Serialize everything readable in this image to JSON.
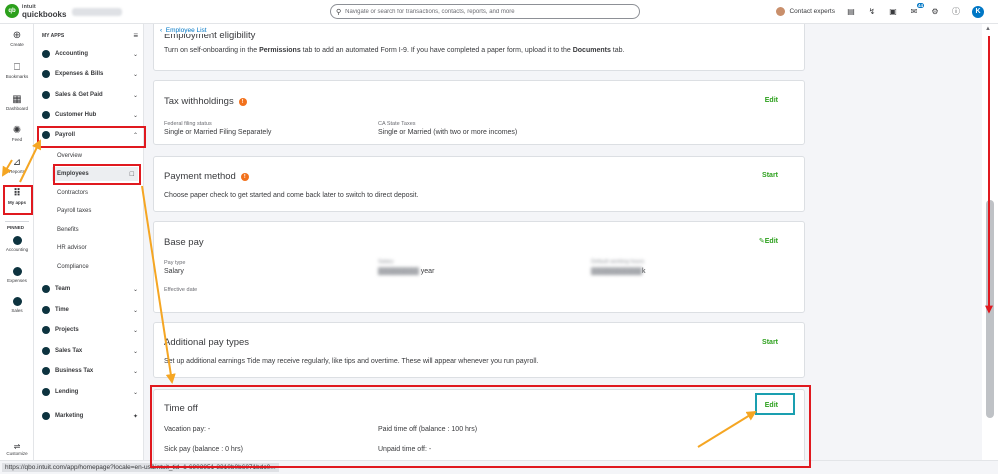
{
  "header": {
    "logo_brand": "intuit",
    "logo_product": "quickbooks",
    "logo_initials": "qb",
    "search_placeholder": "Navigate or search for transactions, contacts, reports, and more",
    "contact_label": "Contact experts",
    "notification_badge": "44",
    "avatar_initial": "K"
  },
  "rail": {
    "items": [
      {
        "label": "Create",
        "icon": "plus-circle-icon",
        "glyph": "⊕"
      },
      {
        "label": "Bookmarks",
        "icon": "bookmark-icon",
        "glyph": "⎕"
      },
      {
        "label": "Dashboard",
        "icon": "dashboard-icon",
        "glyph": "▦"
      },
      {
        "label": "Feed",
        "icon": "feed-icon",
        "glyph": "✺"
      },
      {
        "label": "Reports",
        "icon": "reports-icon",
        "glyph": "⊿"
      },
      {
        "label": "My apps",
        "icon": "apps-grid-icon",
        "glyph": "⠿"
      }
    ],
    "pinned_label": "PINNED",
    "pinned": [
      {
        "label": "Accounting"
      },
      {
        "label": "Expenses"
      },
      {
        "label": "Sales"
      }
    ],
    "bottom_label": "Customize"
  },
  "sidebar": {
    "heading": "MY APPS",
    "items": [
      {
        "label": "Accounting",
        "chevron": "⌄"
      },
      {
        "label": "Expenses & Bills",
        "chevron": "⌄"
      },
      {
        "label": "Sales & Get Paid",
        "chevron": "⌄"
      },
      {
        "label": "Customer Hub",
        "chevron": "⌄"
      },
      {
        "label": "Payroll",
        "chevron": "⌃"
      }
    ],
    "payroll_sub": [
      "Overview",
      "Employees",
      "Contractors",
      "Payroll taxes",
      "Benefits",
      "HR advisor",
      "Compliance"
    ],
    "items2": [
      {
        "label": "Team",
        "chevron": "⌄"
      },
      {
        "label": "Time",
        "chevron": "⌄"
      },
      {
        "label": "Projects",
        "chevron": "⌄"
      },
      {
        "label": "Sales Tax",
        "chevron": "⌄"
      },
      {
        "label": "Business Tax",
        "chevron": "⌄"
      },
      {
        "label": "Lending",
        "chevron": "⌄"
      }
    ],
    "marketing": "Marketing"
  },
  "main": {
    "back_label": "Employee List",
    "eligibility": {
      "title": "Employment eligibility",
      "desc_pre": "Turn on self-onboarding in the ",
      "desc_b1": "Permissions",
      "desc_mid": " tab to add an automated Form I-9. If you have completed a paper form, upload it to the ",
      "desc_b2": "Documents",
      "desc_post": " tab."
    },
    "tax": {
      "title": "Tax withholdings",
      "action": "Edit",
      "fed_label": "Federal filing status",
      "fed_value": "Single or Married Filing Separately",
      "state_label": "CA State Taxes",
      "state_value": "Single or Married (with two or more incomes)"
    },
    "payment": {
      "title": "Payment method",
      "action": "Start",
      "desc": "Choose paper check to get started and come back later to switch to direct deposit."
    },
    "basepay": {
      "title": "Base pay",
      "action": "Edit",
      "type_label": "Pay type",
      "type_value": "Salary",
      "salary_label": "Salary",
      "salary_value": "year",
      "hours_label": "Default working hours",
      "hours_value": "k",
      "effective_label": "Effective date"
    },
    "additional": {
      "title": "Additional pay types",
      "action": "Start",
      "desc": "Set up additional earnings Tide may receive regularly, like tips and overtime. These will appear whenever you run payroll."
    },
    "timeoff": {
      "title": "Time off",
      "action": "Edit",
      "vacation": "Vacation pay: -",
      "paid": "Paid time off (balance : 100 hrs)",
      "sick": "Sick pay (balance : 0 hrs)",
      "unpaid": "Unpaid time off: -"
    }
  },
  "status_url": "https://qbo.intuit.com/app/homepage?locale=en-us&intuit_tid=1-6903951-3310b0b6071bdc0...",
  "colors": {
    "accent_green": "#2ca01c",
    "highlight_red": "#e0191f",
    "highlight_teal": "#1a9fb0",
    "arrow_orange": "#f5a623"
  }
}
